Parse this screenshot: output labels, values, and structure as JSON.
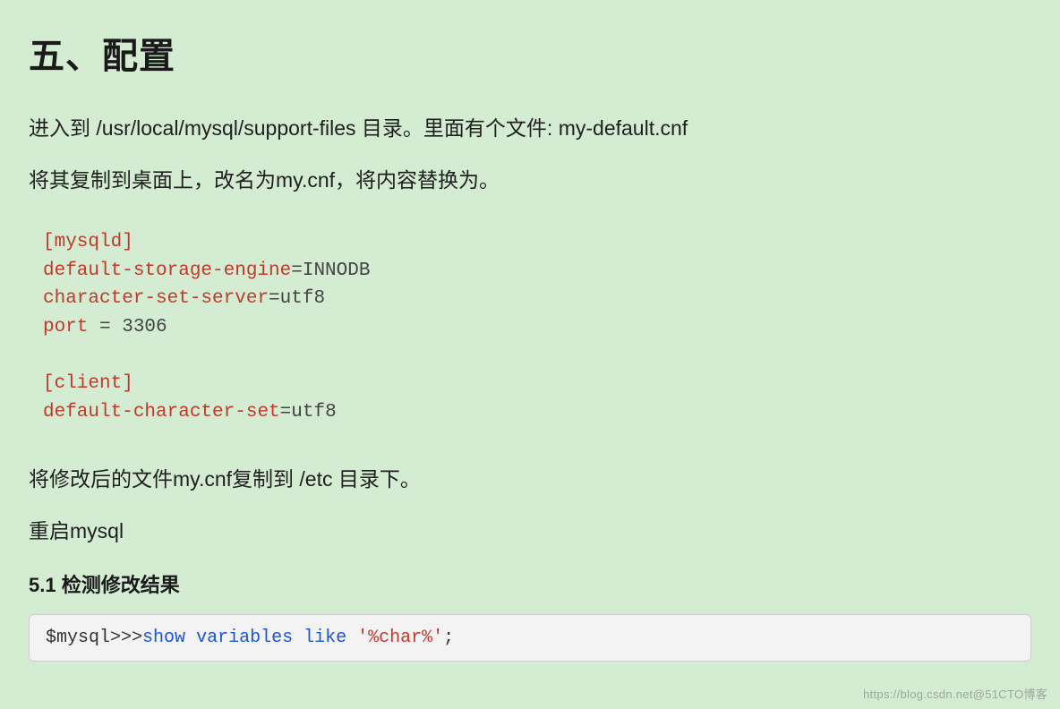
{
  "title": "五、配置",
  "paragraphs": {
    "p1": "进入到 /usr/local/mysql/support-files 目录。里面有个文件: my-default.cnf",
    "p2": "将其复制到桌面上，改名为my.cnf，将内容替换为。",
    "p3": "将修改后的文件my.cnf复制到 /etc 目录下。",
    "p4": "重启mysql"
  },
  "config": {
    "line1_key": "[mysqld]",
    "line2_key": "default-storage-engine",
    "line2_val": "=INNODB",
    "line3_key": "character-set-server",
    "line3_val": "=utf8",
    "line4_key": "port",
    "line4_val": " = 3306",
    "line5_key": "[client]",
    "line6_key": "default-character-set",
    "line6_val": "=utf8"
  },
  "subsection": "5.1 检测修改结果",
  "command": {
    "prefix": "$mysql>>>",
    "show": "show",
    "variables": "variables",
    "like": "like",
    "arg": "'%char%'",
    "semi": ";"
  },
  "watermark": "https://blog.csdn.net@51CTO博客"
}
